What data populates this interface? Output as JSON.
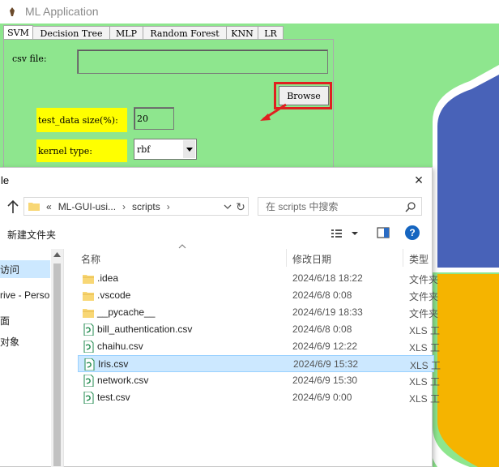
{
  "app": {
    "title": "ML Application",
    "tabs": [
      "SVM",
      "Decision Tree",
      "MLP",
      "Random Forest",
      "KNN",
      "LR"
    ],
    "active_tab": "SVM",
    "csv_label": "csv file:",
    "csv_value": "",
    "browse_label": "Browse",
    "test_size_label": "test_data size(%):",
    "test_size_value": "20",
    "kernel_label": "kernel type:",
    "kernel_value": "rbf",
    "highlight_color": "#e02020",
    "panel_color": "#8ee68e",
    "label_bg": "#ffff00"
  },
  "dialog": {
    "title": "le",
    "address": {
      "prefix": "«",
      "crumbs": [
        "ML-GUI-usi...",
        "scripts"
      ]
    },
    "search_placeholder": "在 scripts 中搜索",
    "new_folder_label": "新建文件夹",
    "nav_items": [
      "访问",
      "rive - Perso",
      "面",
      "对象"
    ],
    "columns": {
      "name": "名称",
      "date": "修改日期",
      "type": "类型"
    },
    "files": [
      {
        "name": ".idea",
        "date": "2024/6/18 18:22",
        "type": "文件夹",
        "icon": "folder-icon"
      },
      {
        "name": ".vscode",
        "date": "2024/6/8 0:08",
        "type": "文件夹",
        "icon": "folder-icon"
      },
      {
        "name": "__pycache__",
        "date": "2024/6/19 18:33",
        "type": "文件夹",
        "icon": "folder-icon"
      },
      {
        "name": "bill_authentication.csv",
        "date": "2024/6/8 0:08",
        "type": "XLS 工",
        "icon": "csv-file-icon"
      },
      {
        "name": "chaihu.csv",
        "date": "2024/6/9 12:22",
        "type": "XLS 工",
        "icon": "csv-file-icon"
      },
      {
        "name": "Iris.csv",
        "date": "2024/6/9 15:32",
        "type": "XLS 工",
        "icon": "csv-file-icon",
        "selected": true
      },
      {
        "name": "network.csv",
        "date": "2024/6/9 15:30",
        "type": "XLS 工",
        "icon": "csv-file-icon"
      },
      {
        "name": "test.csv",
        "date": "2024/6/9 0:00",
        "type": "XLS 工",
        "icon": "csv-file-icon"
      }
    ]
  }
}
